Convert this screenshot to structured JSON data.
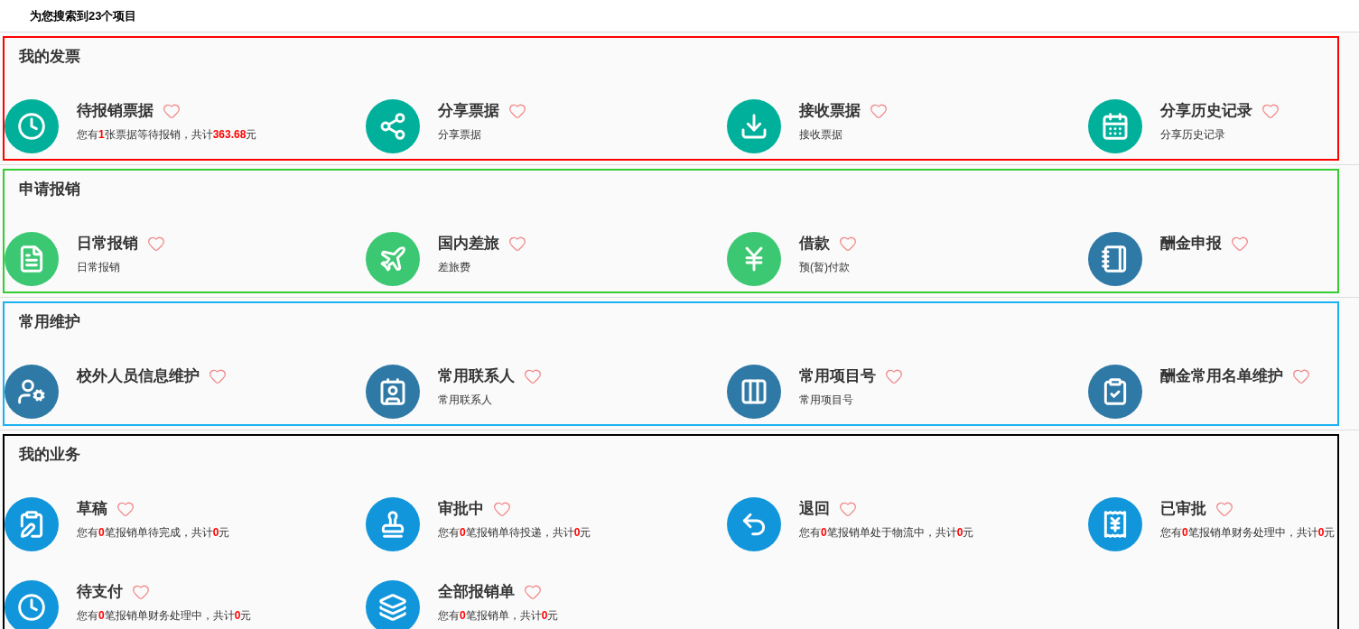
{
  "header": {
    "text": "为您搜索到23个项目"
  },
  "sections": [
    {
      "title": "我的发票",
      "color": "#ff0000",
      "items": [
        {
          "title": "待报销票据",
          "desc": "您有**1**张票据等待报销，共计**363.68**元",
          "color": "#00b09b"
        },
        {
          "title": "分享票据",
          "desc": "分享票据",
          "color": "#00b09b"
        },
        {
          "title": "接收票据",
          "desc": "接收票据",
          "color": "#00b09b"
        },
        {
          "title": "分享历史记录",
          "desc": "分享历史记录",
          "color": "#00b09b"
        }
      ]
    },
    {
      "title": "申请报销",
      "color": "#33cc33",
      "items": [
        {
          "title": "日常报销",
          "desc": "日常报销",
          "color": "#3cc872"
        },
        {
          "title": "国内差旅",
          "desc": "差旅费",
          "color": "#3cc872"
        },
        {
          "title": "借款",
          "desc": "预(暂)付款",
          "color": "#3cc872"
        },
        {
          "title": "酬金申报",
          "color": "#2f79a6"
        }
      ]
    },
    {
      "title": "常用维护",
      "color": "#1ab2f0",
      "items": [
        {
          "title": "校外人员信息维护",
          "color": "#2f79a6"
        },
        {
          "title": "常用联系人",
          "desc": "常用联系人",
          "color": "#2f79a6"
        },
        {
          "title": "常用项目号",
          "desc": "常用项目号",
          "color": "#2f79a6"
        },
        {
          "title": "酬金常用名单维护",
          "color": "#2f79a6"
        }
      ]
    },
    {
      "title": "我的业务",
      "color": "#000000",
      "items": [
        {
          "title": "草稿",
          "desc": "您有**0**笔报销单待完成，共计**0**元",
          "color": "#1296db"
        },
        {
          "title": "审批中",
          "desc": "您有**0**笔报销单待投递，共计**0**元",
          "color": "#1296db"
        },
        {
          "title": "退回",
          "desc": "您有**0**笔报销单处于物流中，共计**0**元",
          "color": "#1296db"
        },
        {
          "title": "已审批",
          "desc": "您有**0**笔报销单财务处理中，共计**0**元",
          "color": "#1296db"
        },
        {
          "title": "待支付",
          "desc": "您有**0**笔报销单财务处理中，共计**0**元",
          "color": "#1296db"
        },
        {
          "title": "全部报销单",
          "desc": "您有**0**笔报销单，共计**0**元",
          "color": "#1296db"
        }
      ]
    }
  ]
}
